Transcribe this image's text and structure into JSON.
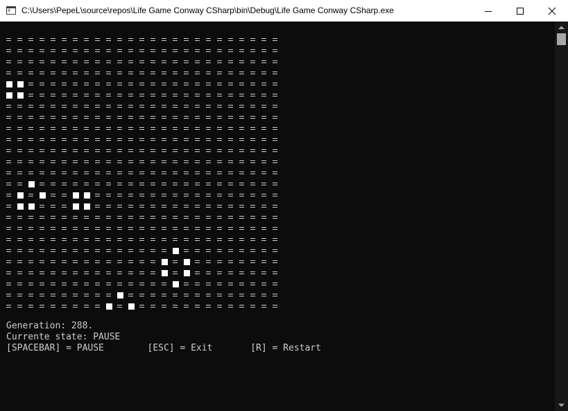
{
  "window": {
    "title": "C:\\Users\\PepeL\\source\\repos\\Life Game Conway CSharp\\bin\\Debug\\Life Game Conway CSharp.exe",
    "icon": "console-app-icon",
    "controls": [
      "minimize-icon",
      "maximize-icon",
      "close-icon"
    ]
  },
  "colors": {
    "console_bg": "#0c0c0c",
    "console_text": "#cccccc",
    "alive_cell": "#ffffff",
    "titlebar_bg": "#ffffff"
  },
  "board": {
    "rows": 25,
    "cols": 25,
    "dead_glyph": "=",
    "alive_glyph": "■",
    "alive_cells": [
      [
        4,
        0
      ],
      [
        4,
        1
      ],
      [
        5,
        0
      ],
      [
        5,
        1
      ],
      [
        13,
        2
      ],
      [
        14,
        1
      ],
      [
        14,
        3
      ],
      [
        14,
        6
      ],
      [
        14,
        7
      ],
      [
        15,
        1
      ],
      [
        15,
        2
      ],
      [
        15,
        6
      ],
      [
        15,
        7
      ],
      [
        19,
        15
      ],
      [
        20,
        14
      ],
      [
        20,
        16
      ],
      [
        21,
        14
      ],
      [
        21,
        16
      ],
      [
        22,
        15
      ],
      [
        23,
        10
      ],
      [
        24,
        9
      ],
      [
        24,
        11
      ]
    ]
  },
  "status": {
    "generation": "Generation: 288.",
    "state": "Currente state: PAUSE",
    "controls": "[SPACEBAR] = PAUSE        [ESC] = Exit       [R] = Restart"
  },
  "scrollbar": {
    "up": "scroll-up-arrow-icon",
    "down": "scroll-down-arrow-icon"
  }
}
